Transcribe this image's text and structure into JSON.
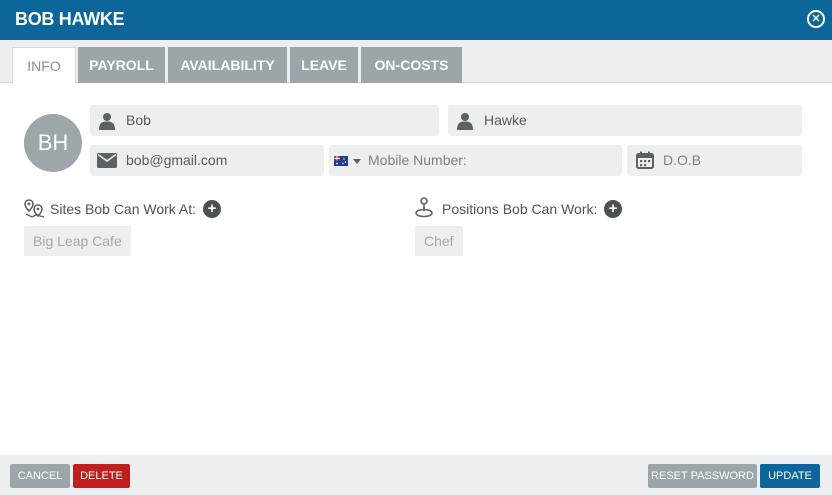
{
  "header": {
    "title": "BOB HAWKE",
    "close_icon": "close-circle-icon"
  },
  "tabs": [
    {
      "label": "INFO",
      "active": true
    },
    {
      "label": "PAYROLL",
      "active": false
    },
    {
      "label": "AVAILABILITY",
      "active": false
    },
    {
      "label": "LEAVE",
      "active": false
    },
    {
      "label": "ON-COSTS",
      "active": false
    }
  ],
  "profile": {
    "avatar_initials": "BH",
    "first_name": "Bob",
    "last_name": "Hawke",
    "email": "bob@gmail.com",
    "mobile_placeholder": "Mobile Number:",
    "dob_placeholder": "D.O.B"
  },
  "sites": {
    "label": "Sites Bob Can Work At:",
    "items": [
      "Big Leap Cafe"
    ]
  },
  "positions": {
    "label": "Positions Bob Can Work:",
    "items": [
      "Chef"
    ]
  },
  "footer": {
    "cancel": "CANCEL",
    "delete": "DELETE",
    "reset_password": "RESET PASSWORD",
    "update": "UPDATE"
  },
  "colors": {
    "header": "#0d6699",
    "tab_inactive": "#9ca5a9",
    "input_bg": "#eceeef",
    "delete": "#c0201d",
    "update": "#0d6699",
    "neutral_button": "#9ca5a9"
  }
}
